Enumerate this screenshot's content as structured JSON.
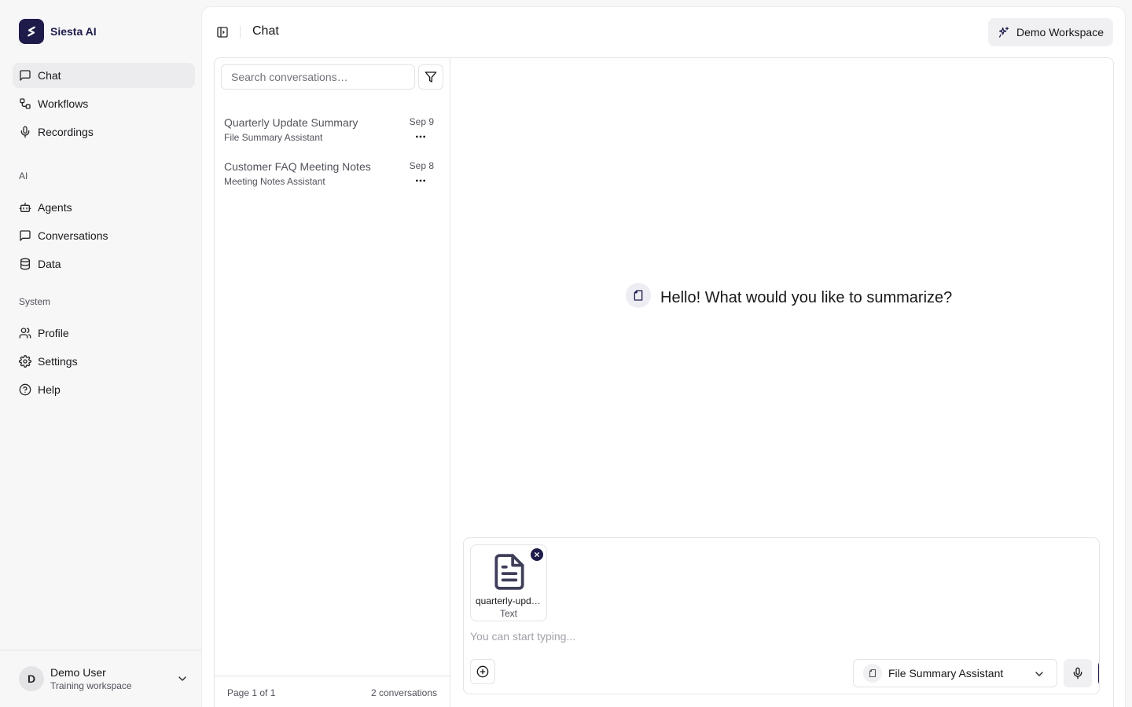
{
  "brand": {
    "name": "Siesta AI",
    "logo_icon": "siesta-logo-icon",
    "color": "#1e1b4b"
  },
  "sidebar": {
    "primary": [
      {
        "label": "Chat",
        "icon": "message-square-icon",
        "active": true
      },
      {
        "label": "Workflows",
        "icon": "workflow-icon"
      },
      {
        "label": "Recordings",
        "icon": "mic-icon"
      }
    ],
    "ai_section": "AI",
    "ai": [
      {
        "label": "Agents",
        "icon": "bot-icon"
      },
      {
        "label": "Conversations",
        "icon": "message-square-icon"
      },
      {
        "label": "Data",
        "icon": "database-icon"
      }
    ],
    "system_section": "System",
    "system": [
      {
        "label": "Profile",
        "icon": "users-icon"
      },
      {
        "label": "Settings",
        "icon": "gear-icon"
      },
      {
        "label": "Help",
        "icon": "help-circle-icon"
      }
    ]
  },
  "user": {
    "initial": "D",
    "name": "Demo User",
    "workspace": "Training workspace"
  },
  "header": {
    "title": "Chat",
    "workspace_button": "Demo Workspace"
  },
  "conversations": {
    "search_placeholder": "Search conversations…",
    "items": [
      {
        "title": "Quarterly Update Summary",
        "assistant": "File Summary Assistant",
        "date": "Sep 9"
      },
      {
        "title": "Customer FAQ Meeting Notes",
        "assistant": "Meeting Notes Assistant",
        "date": "Sep 8"
      }
    ],
    "page_info": "Page 1 of 1",
    "count": "2 conversations"
  },
  "chat": {
    "greeting": "Hello! What would you like to summarize?",
    "attachment": {
      "name": "quarterly-update",
      "type": "Text"
    },
    "input_placeholder": "You can start typing...",
    "agent": "File Summary Assistant"
  }
}
